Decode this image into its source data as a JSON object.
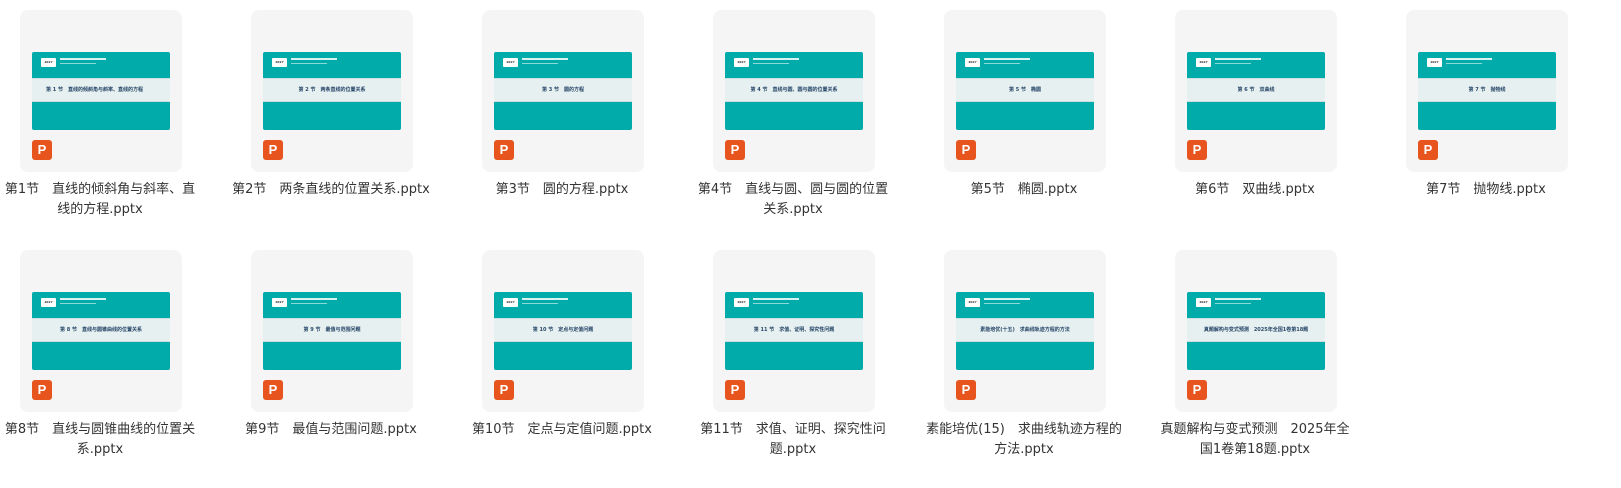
{
  "files": [
    {
      "name": "第1节　直线的倾斜角与斜率、直线的方程.pptx",
      "slide_title": "第 1 节　直线的倾斜角与斜率、直线的方程",
      "thumb_badge": "2027",
      "icon": "pptx-icon"
    },
    {
      "name": "第2节　两条直线的位置关系.pptx",
      "slide_title": "第 2 节　两条直线的位置关系",
      "thumb_badge": "2027",
      "icon": "pptx-icon"
    },
    {
      "name": "第3节　圆的方程.pptx",
      "slide_title": "第 3 节　圆的方程",
      "thumb_badge": "2027",
      "icon": "pptx-icon"
    },
    {
      "name": "第4节　直线与圆、圆与圆的位置关系.pptx",
      "slide_title": "第 4 节　直线与圆、圆与圆的位置关系",
      "thumb_badge": "2027",
      "icon": "pptx-icon"
    },
    {
      "name": "第5节　椭圆.pptx",
      "slide_title": "第 5 节　椭圆",
      "thumb_badge": "2027",
      "icon": "pptx-icon"
    },
    {
      "name": "第6节　双曲线.pptx",
      "slide_title": "第 6 节　双曲线",
      "thumb_badge": "2027",
      "icon": "pptx-icon"
    },
    {
      "name": "第7节　抛物线.pptx",
      "slide_title": "第 7 节　抛物线",
      "thumb_badge": "2027",
      "icon": "pptx-icon"
    },
    {
      "name": "第8节　直线与圆锥曲线的位置关系.pptx",
      "slide_title": "第 8 节　直线与圆锥曲线的位置关系",
      "thumb_badge": "2027",
      "icon": "pptx-icon"
    },
    {
      "name": "第9节　最值与范围问题.pptx",
      "slide_title": "第 9 节　最值与范围问题",
      "thumb_badge": "2027",
      "icon": "pptx-icon"
    },
    {
      "name": "第10节　定点与定值问题.pptx",
      "slide_title": "第 10 节　定点与定值问题",
      "thumb_badge": "2027",
      "icon": "pptx-icon"
    },
    {
      "name": "第11节　求值、证明、探究性问题.pptx",
      "slide_title": "第 11 节　求值、证明、探究性问题",
      "thumb_badge": "2027",
      "icon": "pptx-icon"
    },
    {
      "name": "素能培优(15)　求曲线轨迹方程的方法.pptx",
      "slide_title": "素能培优(十五)　求曲线轨迹方程的方法",
      "thumb_badge": "2027",
      "icon": "pptx-icon"
    },
    {
      "name": "真题解构与变式预测　2025年全国1卷第18题.pptx",
      "slide_title": "真题解构与变式预测　2025年全国1卷第18题",
      "thumb_badge": "2027",
      "icon": "pptx-icon"
    }
  ],
  "icon_letter": "P",
  "colors": {
    "card_bg": "#f5f5f5",
    "slide_teal": "#00aba9",
    "slide_band": "#e7f0f1",
    "ppt_icon": "#e8541e",
    "name_text": "#333333"
  }
}
